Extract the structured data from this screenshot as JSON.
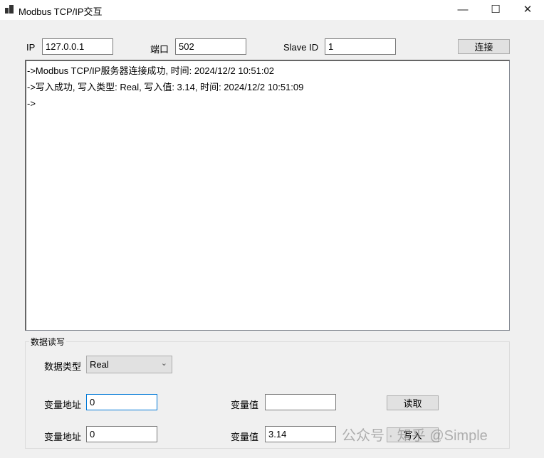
{
  "window": {
    "title": "Modbus TCP/IP交互",
    "minimize": "—",
    "maximize": "☐",
    "close": "✕"
  },
  "connection": {
    "ip_label": "IP",
    "ip_value": "127.0.0.1",
    "port_label": "端口",
    "port_value": "502",
    "slave_label": "Slave ID",
    "slave_value": "1",
    "connect_button": "连接"
  },
  "log": [
    "->Modbus TCP/IP服务器连接成功, 时间: 2024/12/2 10:51:02",
    "->写入成功, 写入类型: Real, 写入值: 3.14, 时间: 2024/12/2 10:51:09",
    "->"
  ],
  "data_rw": {
    "group_title": "数据读写",
    "type_label": "数据类型",
    "type_value": "Real",
    "read": {
      "addr_label": "变量地址",
      "addr_value": "0",
      "val_label": "变量值",
      "val_value": "",
      "button": "读取"
    },
    "write": {
      "addr_label": "变量地址",
      "addr_value": "0",
      "val_label": "变量值",
      "val_value": "3.14",
      "button": "写入"
    }
  },
  "watermark": "公众号 · 知乎 @Simple"
}
